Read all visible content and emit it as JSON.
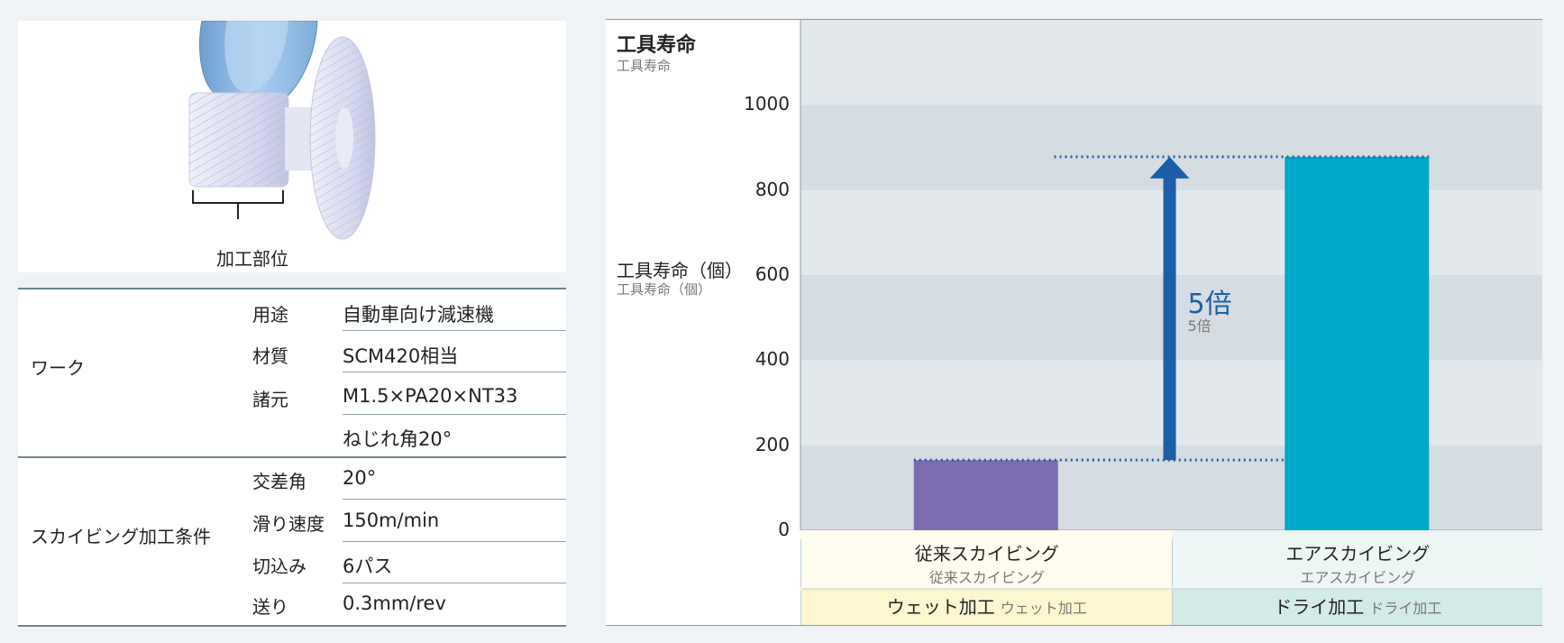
{
  "gear_figure": {
    "part_label": "加工部位"
  },
  "spec_table": {
    "groups": [
      {
        "name": "ワーク",
        "rows": [
          {
            "key": "用途",
            "value": "自動車向け減速機"
          },
          {
            "key": "材質",
            "value": "SCM420相当"
          },
          {
            "key": "諸元",
            "value": "M1.5×PA20×NT33"
          },
          {
            "key": "",
            "value": "ねじれ角20°"
          }
        ]
      },
      {
        "name": "スカイビング加工条件",
        "rows": [
          {
            "key": "交差角",
            "value": "20°"
          },
          {
            "key": "滑り速度",
            "value": "150m/min"
          },
          {
            "key": "切込み",
            "value": "6パス"
          },
          {
            "key": "送り",
            "value": "0.3mm/rev"
          }
        ]
      }
    ]
  },
  "chart_data": {
    "type": "bar",
    "title": "工具寿命",
    "title_sub": "工具寿命",
    "ylabel": "工具寿命（個）",
    "ylabel_sub": "工具寿命（個）",
    "ylim": [
      0,
      1200
    ],
    "yticks": [
      0,
      200,
      400,
      600,
      800,
      1000
    ],
    "categories": [
      "従来スカイビング",
      "エアスカイビング"
    ],
    "categories_sub": [
      "従来スカイビング",
      "エアスカイビング"
    ],
    "values": [
      165,
      878
    ],
    "bar_colors": [
      "#7b6db0",
      "#00a8c8"
    ],
    "methods": [
      "ウェット加工",
      "ドライ加工"
    ],
    "methods_sub": [
      "ウェット加工",
      "ドライ加工"
    ],
    "method_colors": [
      "#fdf7cf",
      "#d3ebe6"
    ],
    "category_bg_colors": [
      "#fffdef",
      "#edf6f4"
    ],
    "ratio_label": "5倍",
    "ratio_label_sub": "5倍",
    "arrow_color": "#1c5ea8",
    "grid": "alternating horizontal bands"
  }
}
